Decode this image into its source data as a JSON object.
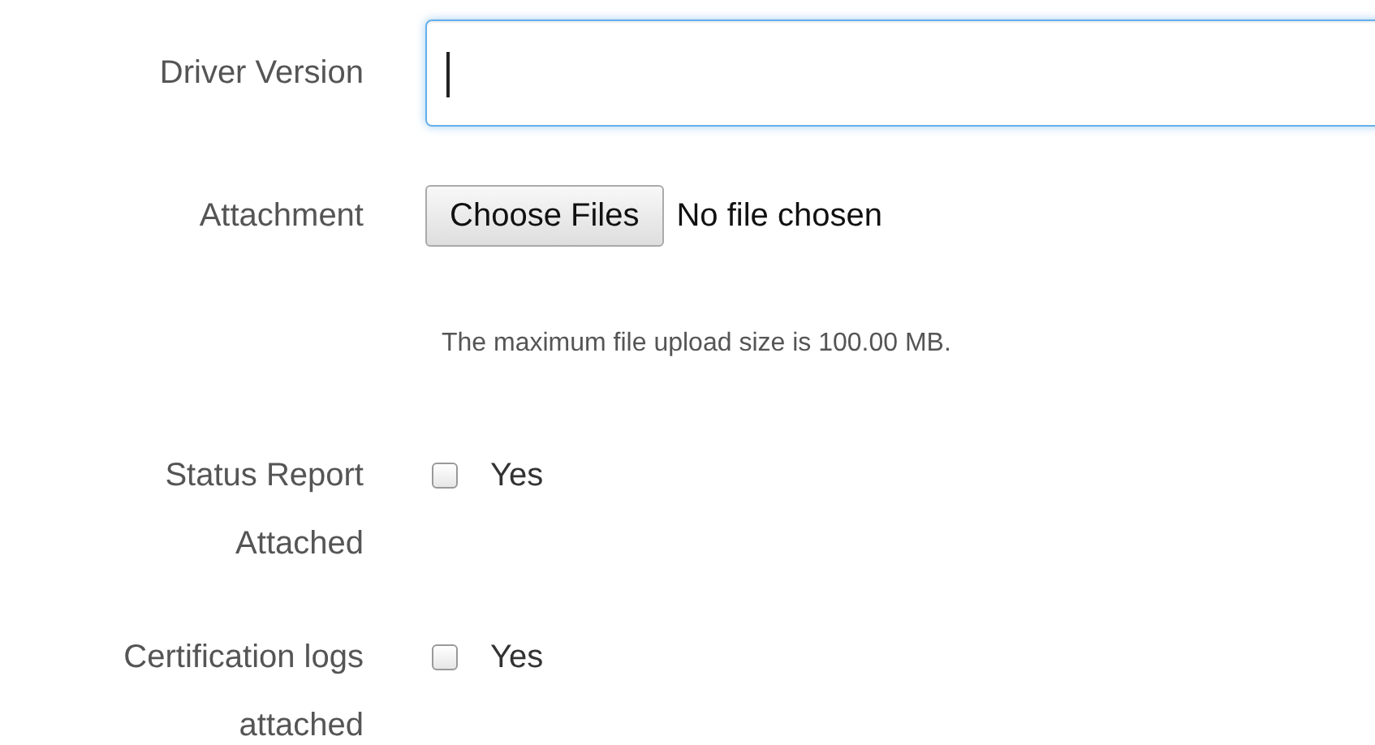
{
  "driver_version": {
    "label": "Driver Version",
    "focused": true
  },
  "attachment": {
    "label": "Attachment",
    "button": "Choose Files",
    "status": "No file chosen",
    "hint": "The maximum file upload size is 100.00 MB."
  },
  "checkboxes": [
    {
      "label": "Status Report Attached",
      "option": "Yes",
      "checked": false
    },
    {
      "label": "Certification logs attached",
      "option": "Yes",
      "checked": false
    }
  ]
}
